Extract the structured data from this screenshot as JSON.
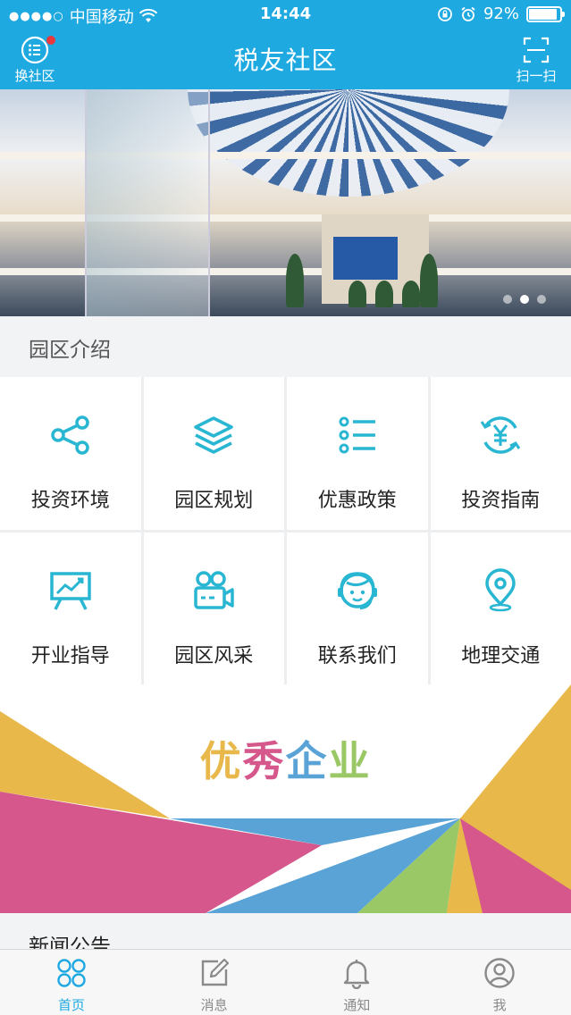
{
  "status_bar": {
    "carrier": "中国移动",
    "time": "14:44",
    "battery": "92%",
    "battery_level": 0.92
  },
  "header": {
    "title": "税友社区",
    "left_label": "换社区",
    "right_label": "扫一扫"
  },
  "banner": {
    "slides": 3,
    "active_index": 1
  },
  "section": {
    "title": "园区介绍"
  },
  "grid": [
    {
      "label": "投资环境",
      "icon": "share-icon"
    },
    {
      "label": "园区规划",
      "icon": "layers-icon"
    },
    {
      "label": "优惠政策",
      "icon": "list-icon"
    },
    {
      "label": "投资指南",
      "icon": "yuan-exchange-icon"
    },
    {
      "label": "开业指导",
      "icon": "presentation-chart-icon"
    },
    {
      "label": "园区风采",
      "icon": "video-camera-icon"
    },
    {
      "label": "联系我们",
      "icon": "customer-service-icon"
    },
    {
      "label": "地理交通",
      "icon": "location-pin-icon"
    }
  ],
  "promo": {
    "title": "优秀企业"
  },
  "news": {
    "title": "新闻公告"
  },
  "tabbar": [
    {
      "label": "首页",
      "icon": "home-grid-icon",
      "active": true
    },
    {
      "label": "消息",
      "icon": "edit-icon",
      "active": false
    },
    {
      "label": "通知",
      "icon": "bell-icon",
      "active": false
    },
    {
      "label": "我",
      "icon": "user-icon",
      "active": false
    }
  ],
  "colors": {
    "primary": "#1fa9e1",
    "icon": "#29b6d2",
    "promo_yellow": "#e8b84b",
    "promo_pink": "#d6578b",
    "promo_blue": "#5aa3d6",
    "promo_green": "#9bc866"
  }
}
